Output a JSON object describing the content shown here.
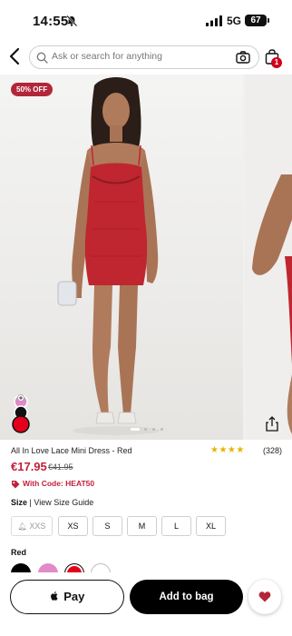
{
  "status_bar": {
    "time": "14:55",
    "network": "5G",
    "battery": "67"
  },
  "header": {
    "search_placeholder": "Ask or search for anything",
    "bag_count": "1"
  },
  "gallery": {
    "sale_badge": "50% OFF",
    "slide_count": 4,
    "active_slide": 1
  },
  "product": {
    "title": "All In Love Lace Mini Dress - Red",
    "stars": "★★★★",
    "rating_count": "(328)",
    "price": "€17.95",
    "old_price": "€41.95",
    "code_text": "With Code: HEAT50"
  },
  "size": {
    "label": "Size",
    "separator": "|",
    "guide_link": "View Size Guide",
    "options": [
      {
        "label": "XXS",
        "available": false
      },
      {
        "label": "XS",
        "available": true
      },
      {
        "label": "S",
        "available": true
      },
      {
        "label": "M",
        "available": true
      },
      {
        "label": "L",
        "available": true
      },
      {
        "label": "XL",
        "available": true
      }
    ]
  },
  "color": {
    "label": "Red",
    "swatches": [
      "#000000",
      "#e28ac9",
      "#e3001b",
      "#ffffff"
    ],
    "selected_index": 2
  },
  "actions": {
    "apple_pay": "Pay",
    "add_to_bag": "Add to bag"
  },
  "colors": {
    "accent": "#c2203a",
    "badge": "#b3263a",
    "star": "#e5b400",
    "button": "#000000"
  }
}
